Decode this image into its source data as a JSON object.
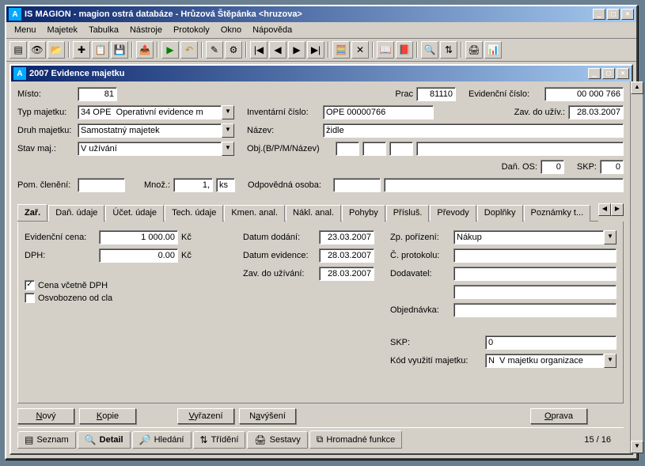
{
  "app": {
    "title": "IS MAGION - magion ostrá databáze - Hrůzová Štěpánka <hruzova>",
    "icon_letter": "A"
  },
  "menu": {
    "items": [
      "Menu",
      "Majetek",
      "Tabulka",
      "Nástroje",
      "Protokoly",
      "Okno",
      "Nápověda"
    ]
  },
  "subwin": {
    "title": "2007 Evidence majetku"
  },
  "form": {
    "misto_lbl": "Místo:",
    "misto": "81",
    "prac_lbl": "Prac",
    "prac": "81110",
    "evid_cislo_lbl": "Evidenční číslo:",
    "evid_cislo": "00 000 766",
    "typ_maj_lbl": "Typ majetku:",
    "typ_maj": "34 OPE  Operativní evidence m",
    "inv_cislo_lbl": "Inventární číslo:",
    "inv_cislo": "OPE 00000766",
    "zav_do_uziv_lbl": "Zav. do užív.:",
    "zav_do_uziv": "28.03.2007",
    "druh_maj_lbl": "Druh majetku:",
    "druh_maj": "Samostatný majetek",
    "nazev_lbl": "Název:",
    "nazev": "židle",
    "stav_maj_lbl": "Stav maj.:",
    "stav_maj": "V užívání",
    "obj_lbl": "Obj.(B/P/M/Název)",
    "dan_os_lbl": "Daň. OS:",
    "dan_os": "0",
    "skp_lbl": "SKP:",
    "skp": "0",
    "pom_clen_lbl": "Pom. členění:",
    "mnoz_lbl": "Množ.:",
    "mnoz": "1,",
    "mnoz_unit": "ks",
    "odpov_osoba_lbl": "Odpovědná osoba:"
  },
  "tabs": {
    "items": [
      "Zař.",
      "Daň. údaje",
      "Účet. údaje",
      "Tech. údaje",
      "Kmen. anal.",
      "Nákl. anal.",
      "Pohyby",
      "Přísluš.",
      "Převody",
      "Doplňky",
      "Poznámky t..."
    ]
  },
  "zar": {
    "evid_cena_lbl": "Evidenční cena:",
    "evid_cena": "1 000.00",
    "evid_cena_unit": "Kč",
    "dph_lbl": "DPH:",
    "dph": "0.00",
    "dph_unit": "Kč",
    "cb_cena_vcetne": "Cena včetně DPH",
    "cb_osvobozeno": "Osvobozeno od cla",
    "datum_dodani_lbl": "Datum dodání:",
    "datum_dodani": "23.03.2007",
    "datum_evid_lbl": "Datum evidence:",
    "datum_evid": "28.03.2007",
    "zav_uziv_lbl": "Zav. do užívání:",
    "zav_uziv": "28.03.2007",
    "zp_poriz_lbl": "Zp. pořízení:",
    "zp_poriz": "Nákup",
    "c_prot_lbl": "Č. protokolu:",
    "dodavatel_lbl": "Dodavatel:",
    "objednavka_lbl": "Objednávka:",
    "skp2_lbl": "SKP:",
    "skp2": "0",
    "kod_vyuz_lbl": "Kód využití majetku:",
    "kod_vyuz": "N  V majetku organizace"
  },
  "buttons": {
    "novy": "Nový",
    "kopie": "Kopie",
    "vyrazeni": "Vyřazení",
    "navyseni": "Navýšení",
    "oprava": "Oprava"
  },
  "bottom_tabs": {
    "seznam": "Seznam",
    "detail": "Detail",
    "hledani": "Hledání",
    "trideni": "Třídění",
    "sestavy": "Sestavy",
    "hromadne": "Hromadné funkce"
  },
  "status": {
    "pager": "15 /   16"
  }
}
